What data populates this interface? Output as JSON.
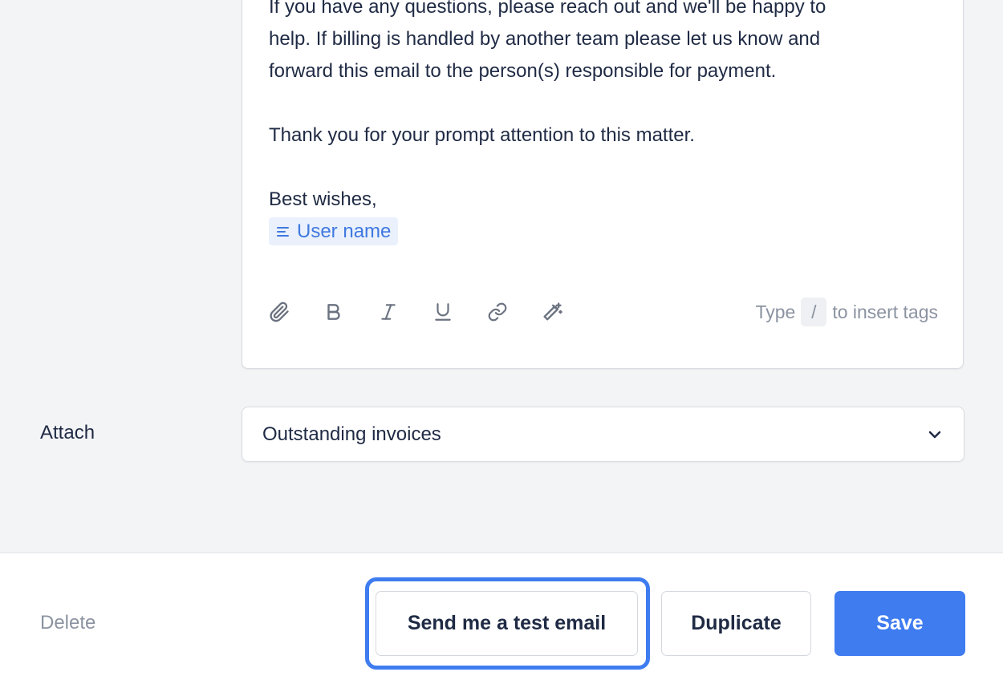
{
  "editor": {
    "lines": [
      "If you have any questions, please reach out and we'll be happy to",
      "help. If billing is handled by another team please let us know and",
      "forward this email to the person(s) responsible for payment."
    ],
    "thanks": "Thank you for your prompt attention to this matter.",
    "signoff": "Best wishes,",
    "tag_label": "User name",
    "toolbar": {
      "icons": [
        "paperclip-icon",
        "bold-icon",
        "italic-icon",
        "underline-icon",
        "link-icon",
        "magic-wand-icon"
      ]
    },
    "hint": {
      "prefix": "Type",
      "key": "/",
      "suffix": "to insert tags"
    }
  },
  "attach": {
    "label": "Attach",
    "selected": "Outstanding invoices"
  },
  "footer": {
    "delete_label": "Delete",
    "test_label": "Send me a test email",
    "duplicate_label": "Duplicate",
    "save_label": "Save"
  },
  "colors": {
    "accent": "#3e7cf0",
    "background": "#f3f4f6",
    "text": "#1f2a44",
    "muted": "#8b93a1",
    "tag_bg": "#eaf1fc",
    "tag_text": "#3f78e0"
  }
}
